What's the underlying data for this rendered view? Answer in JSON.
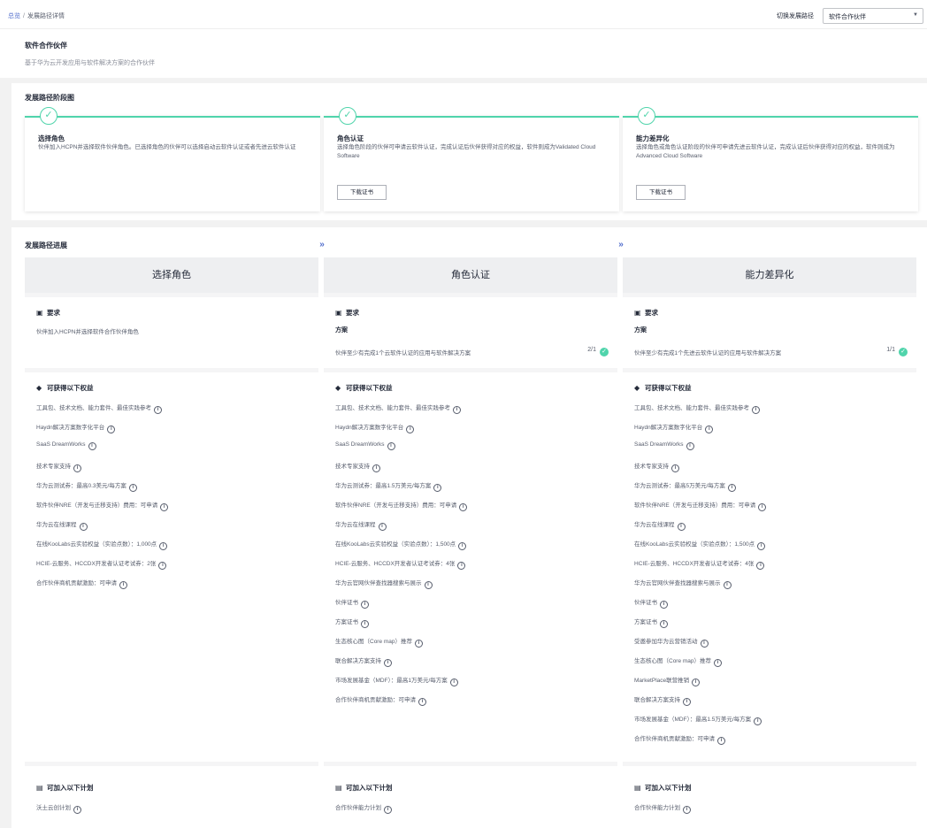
{
  "breadcrumb": {
    "home": "总览",
    "separator": "/",
    "current": "发展路径详情"
  },
  "switch_path": {
    "label": "切换发展路径",
    "selected": "软件合作伙伴"
  },
  "partner": {
    "title": "软件合作伙伴",
    "description": "基于华为云开发应用与软件解决方案的合作伙伴"
  },
  "stage_section": {
    "title": "发展路径阶段图",
    "cards": [
      {
        "title": "选择角色",
        "desc": "伙伴加入HCPN并选择软件伙伴角色。已选择角色的伙伴可以选择启动云软件认证或者先进云软件认证",
        "button": ""
      },
      {
        "title": "角色认证",
        "desc": "选择角色阶段的伙伴可申请云软件认证，完成认证后伙伴获得对应的权益，软件则成为Validated Cloud Software",
        "button": "下载证书"
      },
      {
        "title": "能力差异化",
        "desc": "选择角色或角色认证阶段的伙伴可申请先进云软件认证，完成认证后伙伴获得对应的权益，软件则成为Advanced Cloud Software",
        "button": "下载证书"
      }
    ]
  },
  "progress_section": {
    "title": "发展路径进展",
    "requirement_title": "要求",
    "benefits_title": "可获得以下权益",
    "plans_title": "可加入以下计划",
    "columns": [
      {
        "name": "选择角色",
        "requirement_text": "伙伴加入HCPN并选择软件合作伙伴角色",
        "benefits": [
          "工具包、技术文档、能力套件、最佳实践参考",
          "Haydn解决方案数字化平台",
          "SaaS DreamWorks",
          "技术专家支持",
          "华为云测试券：最高0.3美元/每方案",
          "软件伙伴NRE（开发与迁移支持）费用：可申请",
          "华为云在线课程",
          "在线KooLabs云实验权益（实验点数）：1,000点",
          "HCIE-云服务、HCCDX开发者认证考试券：2张",
          "合作伙伴商机贡献激励：可申请"
        ],
        "plans": [
          "沃土云创计划"
        ]
      },
      {
        "name": "角色认证",
        "scheme_label": "方案",
        "requirement_text": "伙伴至少有完成1个云软件认证的应用与软件解决方案",
        "count": "2/1",
        "benefits": [
          "工具包、技术文档、能力套件、最佳实践参考",
          "Haydn解决方案数字化平台",
          "SaaS DreamWorks",
          "技术专家支持",
          "华为云测试券：最高1.5万美元/每方案",
          "软件伙伴NRE（开发与迁移支持）费用：可申请",
          "华为云在线课程",
          "在线KooLabs云实验权益（实验点数）：1,500点",
          "HCIE-云服务、HCCDX开发者认证考试券：4张",
          "华为云官网伙伴查找器搜索与展示",
          "伙伴证书",
          "方案证书",
          "生态核心图（Core map）推荐",
          "联合解决方案支持",
          "市场发展基金（MDF）：最高1万美元/每方案",
          "合作伙伴商机贡献激励：可申请"
        ],
        "plans": [
          "合作伙伴能力计划"
        ]
      },
      {
        "name": "能力差异化",
        "scheme_label": "方案",
        "requirement_text": "伙伴至少有完成1个先进云软件认证的应用与软件解决方案",
        "count": "1/1",
        "benefits": [
          "工具包、技术文档、能力套件、最佳实践参考",
          "Haydn解决方案数字化平台",
          "SaaS DreamWorks",
          "技术专家支持",
          "华为云测试券：最高5万美元/每方案",
          "软件伙伴NRE（开发与迁移支持）费用：可申请",
          "华为云在线课程",
          "在线KooLabs云实验权益（实验点数）：1,500点",
          "HCIE-云服务、HCCDX开发者认证考试券：4张",
          "华为云官网伙伴查找器搜索与展示",
          "伙伴证书",
          "方案证书",
          "受邀参加华为云营销活动",
          "生态核心图（Core map）推荐",
          "MarketPlace联营推销",
          "联合解决方案支持",
          "市场发展基金（MDF）：最高1.5万美元/每方案",
          "合作伙伴商机贡献激励：可申请"
        ],
        "plans": [
          "合作伙伴能力计划"
        ]
      }
    ]
  },
  "colors": {
    "accent": "#526ecc",
    "success": "#50d4ab"
  },
  "icons": {
    "check": "check-circle-icon",
    "chevron": "double-chevron-right-icon",
    "info": "info-circle-icon",
    "requirement": "clipboard-icon",
    "benefit": "diamond-icon",
    "plan": "document-icon"
  }
}
